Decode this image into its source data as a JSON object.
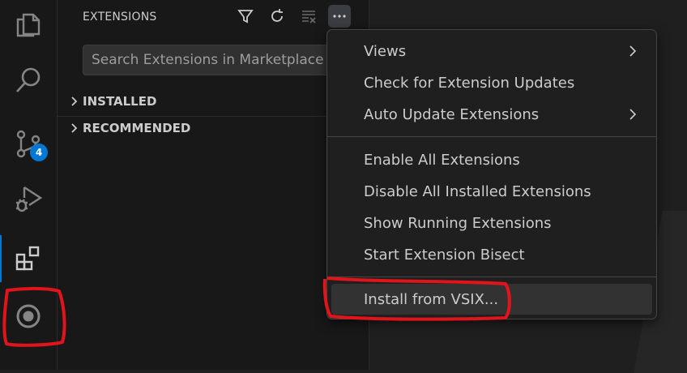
{
  "activity_bar": {
    "items": [
      {
        "name": "explorer-icon"
      },
      {
        "name": "search-icon"
      },
      {
        "name": "source-control-icon",
        "badge": "4"
      },
      {
        "name": "run-debug-icon"
      },
      {
        "name": "extensions-icon"
      },
      {
        "name": "remote-copilot-icon"
      }
    ]
  },
  "sidebar": {
    "title": "EXTENSIONS",
    "actions": [
      "filter-icon",
      "refresh-icon",
      "clear-icon",
      "more-actions-icon"
    ],
    "search_placeholder": "Search Extensions in Marketplace",
    "sections": [
      {
        "label": "INSTALLED"
      },
      {
        "label": "RECOMMENDED"
      }
    ]
  },
  "menu": {
    "groups": [
      [
        {
          "label": "Views",
          "submenu": true
        },
        {
          "label": "Check for Extension Updates",
          "submenu": false
        },
        {
          "label": "Auto Update Extensions",
          "submenu": true
        }
      ],
      [
        {
          "label": "Enable All Extensions",
          "submenu": false
        },
        {
          "label": "Disable All Installed Extensions",
          "submenu": false
        },
        {
          "label": "Show Running Extensions",
          "submenu": false
        },
        {
          "label": "Start Extension Bisect",
          "submenu": false
        }
      ],
      [
        {
          "label": "Install from VSIX...",
          "submenu": false,
          "highlighted": true
        }
      ]
    ]
  },
  "colors": {
    "accent": "#0078d4",
    "annotation": "#e0141b",
    "background": "#1f1f1f",
    "sidebar": "#181818"
  }
}
